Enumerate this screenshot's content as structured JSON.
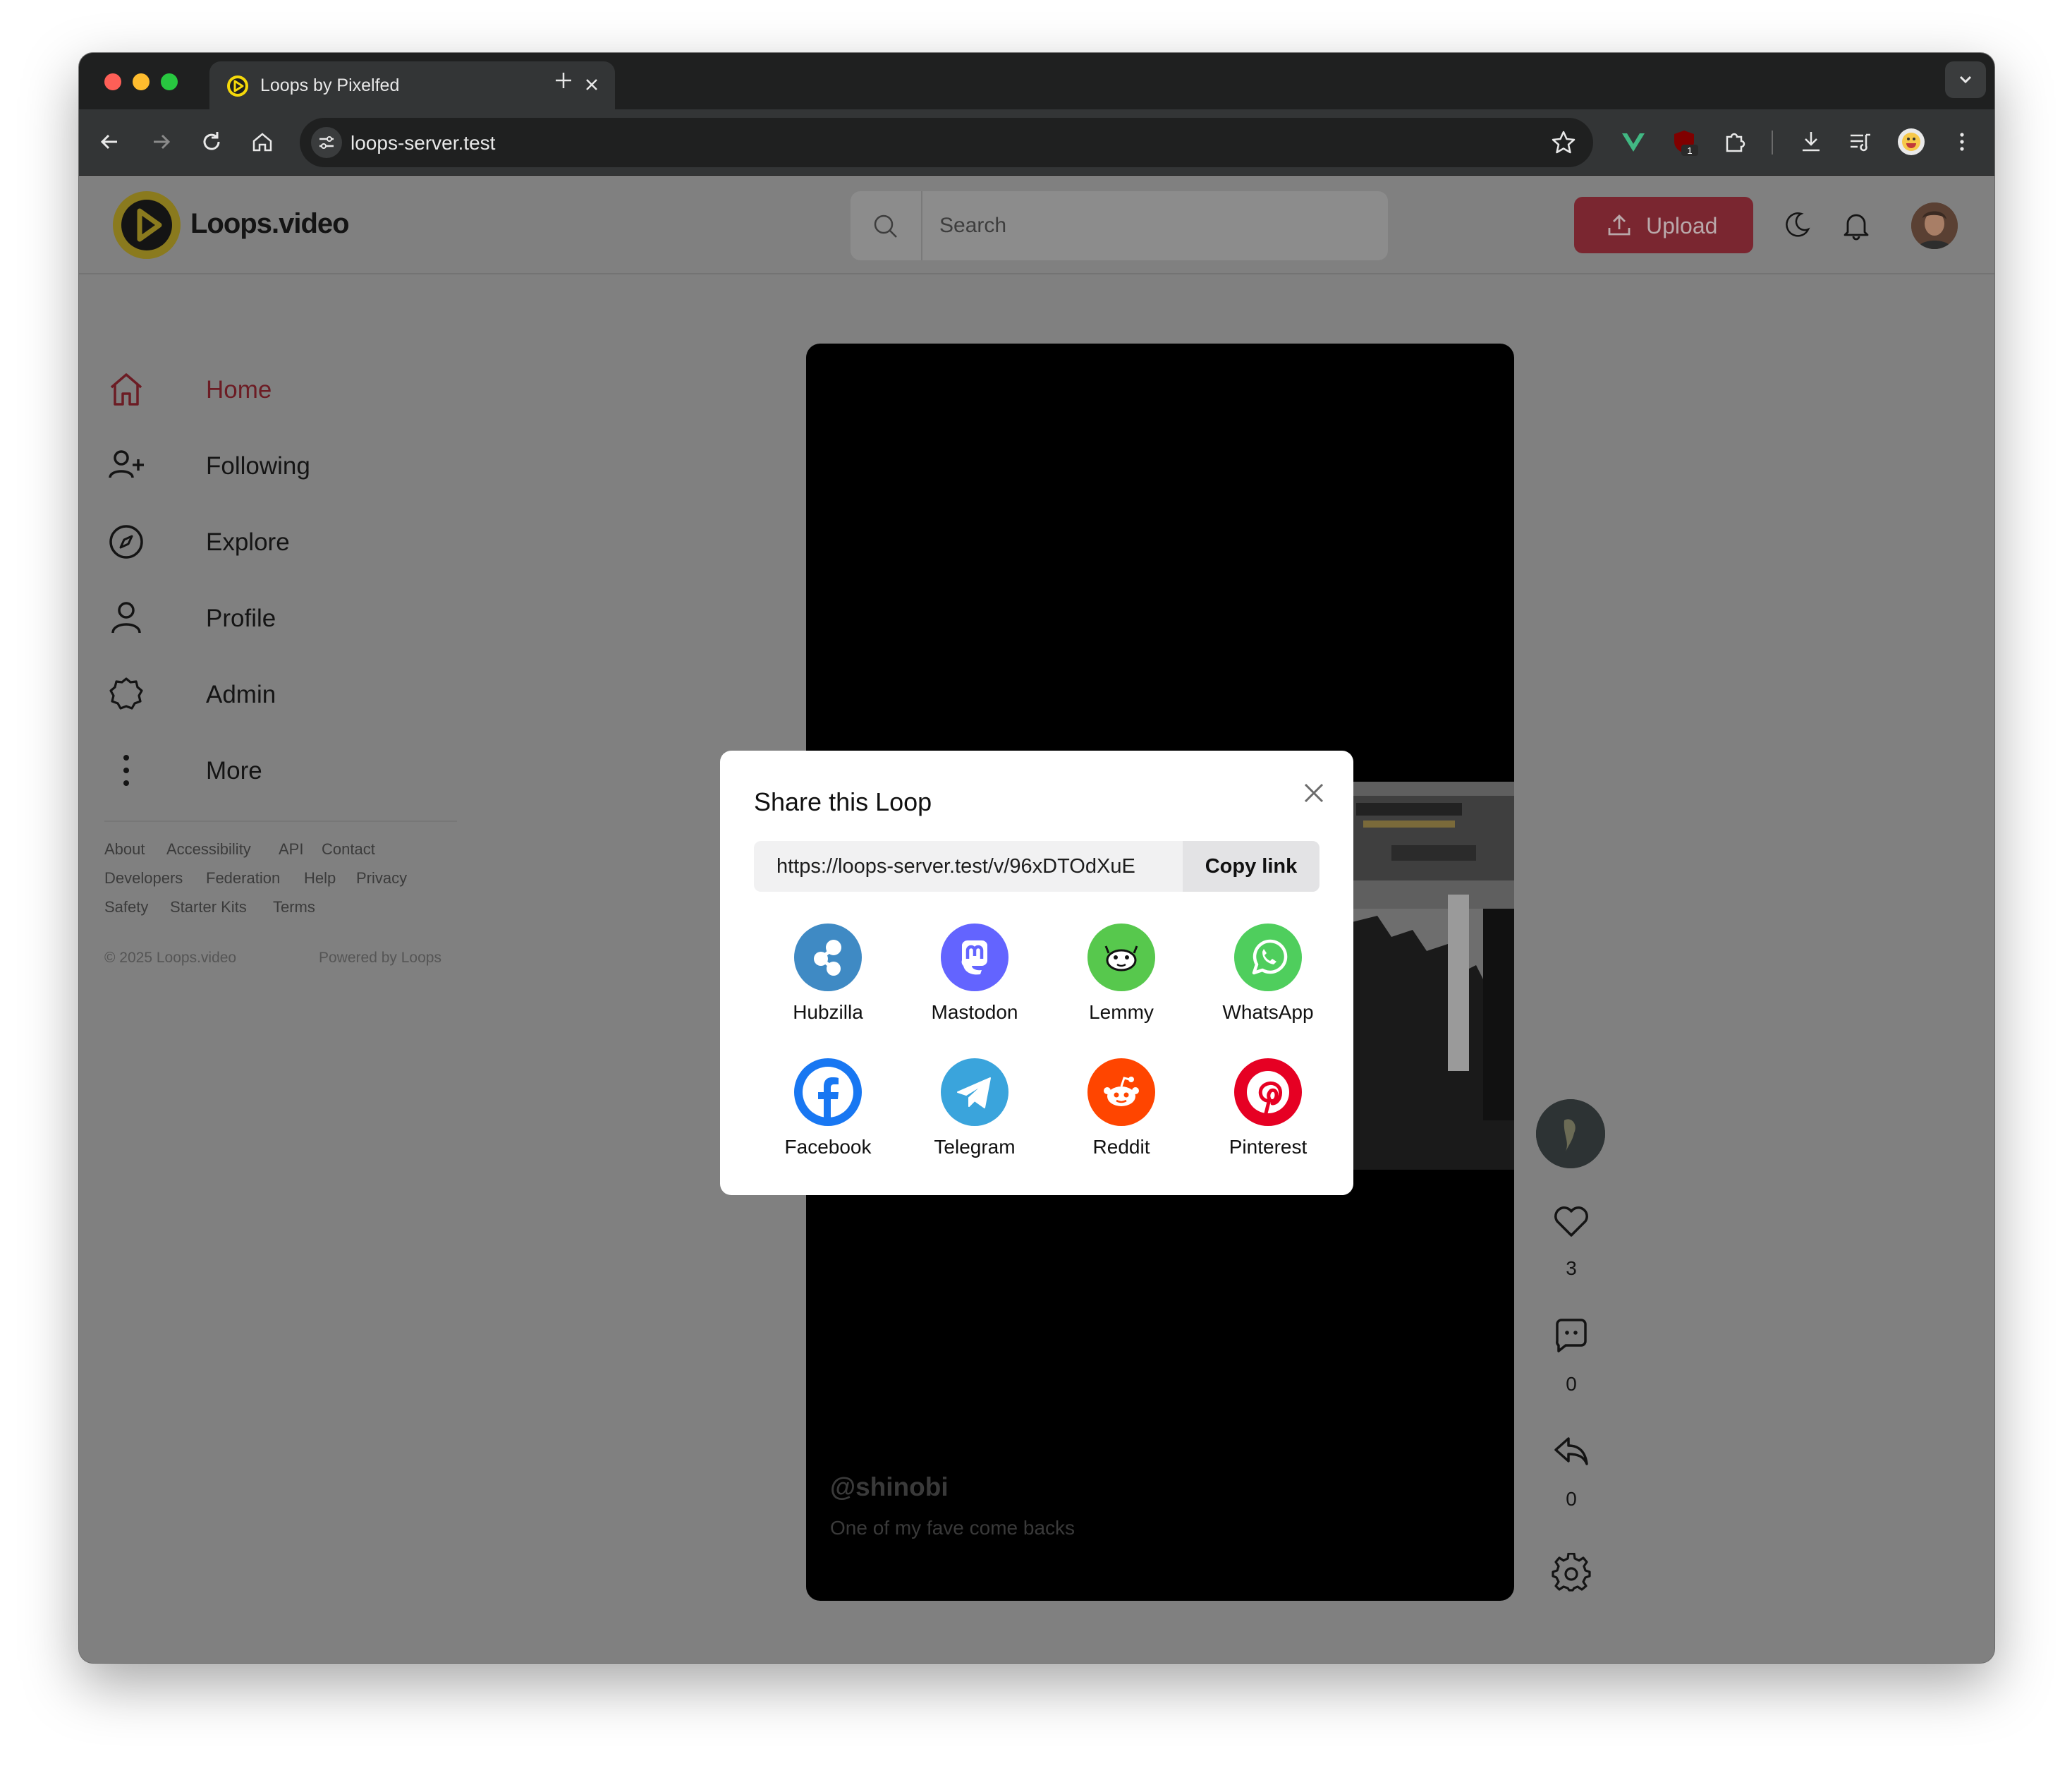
{
  "browser": {
    "tab_title": "Loops by Pixelfed",
    "url": "loops-server.test",
    "extension_badge": "1"
  },
  "header": {
    "brand": "Loops.video",
    "search_placeholder": "Search",
    "upload_label": "Upload"
  },
  "sidebar": {
    "items": [
      {
        "label": "Home",
        "icon": "home-icon"
      },
      {
        "label": "Following",
        "icon": "user-plus-icon"
      },
      {
        "label": "Explore",
        "icon": "compass-icon"
      },
      {
        "label": "Profile",
        "icon": "user-icon"
      },
      {
        "label": "Admin",
        "icon": "badge-icon"
      },
      {
        "label": "More",
        "icon": "more-vertical-icon"
      }
    ],
    "footer_links": [
      "About",
      "Accessibility",
      "API",
      "Contact",
      "Developers",
      "Federation",
      "Help",
      "Privacy",
      "Safety",
      "Starter Kits",
      "Terms"
    ],
    "copyright": "© 2025 Loops.video",
    "powered": "Powered by Loops"
  },
  "video": {
    "username": "@shinobi",
    "caption": "One of my fave come backs",
    "likes": "3",
    "comments": "0",
    "shares": "0"
  },
  "modal": {
    "title": "Share this Loop",
    "link": "https://loops-server.test/v/96xDTOdXuE",
    "copy_label": "Copy link",
    "targets": [
      {
        "label": "Hubzilla",
        "color": "#3f8ac4"
      },
      {
        "label": "Mastodon",
        "color": "#6364ff"
      },
      {
        "label": "Lemmy",
        "color": "#57c84d"
      },
      {
        "label": "WhatsApp",
        "color": "#4fce5d"
      },
      {
        "label": "Facebook",
        "color": "#1877f2"
      },
      {
        "label": "Telegram",
        "color": "#3aa4dc"
      },
      {
        "label": "Reddit",
        "color": "#ff4500"
      },
      {
        "label": "Pinterest",
        "color": "#e60023"
      }
    ]
  },
  "colors": {
    "accent": "#7a2630",
    "overlay": "#808080"
  }
}
